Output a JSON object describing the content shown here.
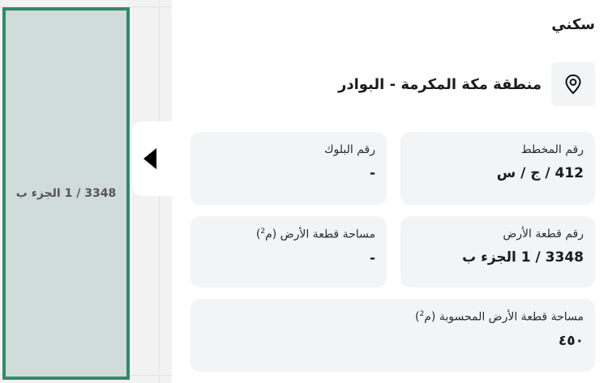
{
  "map": {
    "parcel_label": "3348 / 1 الجزء ب",
    "parcel_color": "#cfdcd9",
    "parcel_border_color": "#2e8b68"
  },
  "panel": {
    "toggle_icon": "chevron-left-icon",
    "land_type": "سكني",
    "location": {
      "icon": "location-pin-icon",
      "text": "منطقة مكة المكرمة - البوادر"
    },
    "cards": {
      "plan_number": {
        "label": "رقم المخطط",
        "value": "412 / ج / س"
      },
      "block_number": {
        "label": "رقم البلوك",
        "value": "-"
      },
      "parcel_number": {
        "label": "رقم قطعة الأرض",
        "value": "3348 / 1 الجزء ب"
      },
      "parcel_area": {
        "label": "مساحة قطعة الأرض (م",
        "unit_exp": "2",
        "label_close": ")",
        "value": "-"
      },
      "calculated_area": {
        "label": "مساحة قطعة الأرض المحسوبة (م",
        "unit_exp": "2",
        "label_close": ")",
        "value": "٤٥٠"
      }
    }
  }
}
